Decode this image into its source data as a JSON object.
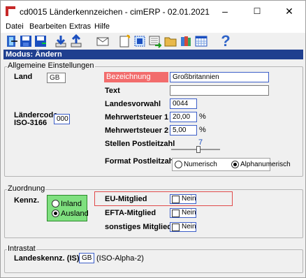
{
  "window": {
    "title": "cd0015 Länderkennzeichen - cimERP - 02.01.2021",
    "minimize": "–",
    "maximize": "☐",
    "close": "✕"
  },
  "menu": {
    "datei": "Datei",
    "bearbeiten": "Bearbeiten",
    "extras": "Extras",
    "hilfe": "Hilfe"
  },
  "toolbar": {
    "help": "?"
  },
  "mode": "Modus: Ändern",
  "allgemein": {
    "legend": "Allgemeine Einstellungen",
    "land_label": "Land",
    "land_value": "GB",
    "laendercode_label1": "Ländercode",
    "laendercode_label2": "ISO-3166",
    "laendercode_value": "000",
    "bezeichnung_label": "Bezeichnung",
    "bezeichnung_value": "Großbritannien",
    "text_label": "Text",
    "text_value": "",
    "vorwahl_label": "Landesvorwahl",
    "vorwahl_value": "0044",
    "mwst1_label": "Mehrwertsteuer 1",
    "mwst1_value": "20,00",
    "mwst1_unit": "%",
    "mwst2_label": "Mehrwertsteuer 2",
    "mwst2_value": "5,00",
    "mwst2_unit": "%",
    "plz_label": "Stellen Postleitzahl",
    "plz_value": "7",
    "format_label": "Format Postleitzahl",
    "format_opt1": "Numerisch",
    "format_opt2": "Alphanumerisch"
  },
  "zuordnung": {
    "legend": "Zuordnung",
    "kennz_label": "Kennz.",
    "inland": "Inland",
    "ausland": "Ausland",
    "eu_label": "EU-Mitglied",
    "eu_value": "Nein",
    "efta_label": "EFTA-Mitglied",
    "efta_value": "Nein",
    "sonst_label": "sonstiges Mitglied",
    "sonst_value": "Nein"
  },
  "intrastat": {
    "legend": "Intrastat",
    "label": "Landeskennz. (IS)",
    "value": "GB",
    "hint": "(ISO-Alpha-2)"
  },
  "colors": {
    "title_bar": "#ffffff",
    "mode_bar": "#1f3f8f",
    "bezeichnung_label_bg": "#f26c6c",
    "kennz_box": "#7fe07f",
    "highlight_border": "#e04a4a"
  }
}
